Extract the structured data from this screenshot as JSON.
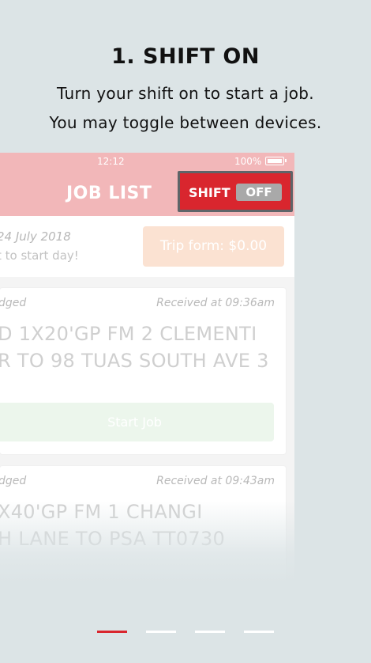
{
  "onboarding": {
    "title": "1. SHIFT ON",
    "subtitle_line1": "Turn your shift on to start a job.",
    "subtitle_line2": "You may toggle between devices."
  },
  "phone": {
    "status_bar": {
      "time": "12:12",
      "battery": "100%"
    },
    "header": {
      "title": "JOB LIST",
      "shift_label": "SHIFT",
      "shift_state": "OFF"
    },
    "day": {
      "date": "24 July 2018",
      "prompt": "t to start day!",
      "trip_form": "Trip form: $0.00"
    },
    "jobs": [
      {
        "status": "dged",
        "received": "Received at 09:36am",
        "line1": "D 1X20'GP FM 2 CLEMENTI",
        "line2": "R TO 98 TUAS SOUTH AVE 3",
        "action": "Start Job"
      },
      {
        "status": "dged",
        "received": "Received at 09:43am",
        "line1": "X40'GP FM 1 CHANGI",
        "line2": "H LANE TO PSA TT0730"
      }
    ]
  },
  "pager": {
    "pages": 4,
    "active_page": 1
  },
  "colors": {
    "background": "#dce4e6",
    "accent": "#d9262e",
    "header": "#f2b7b9",
    "toggle_off": "#a9a9a9"
  }
}
